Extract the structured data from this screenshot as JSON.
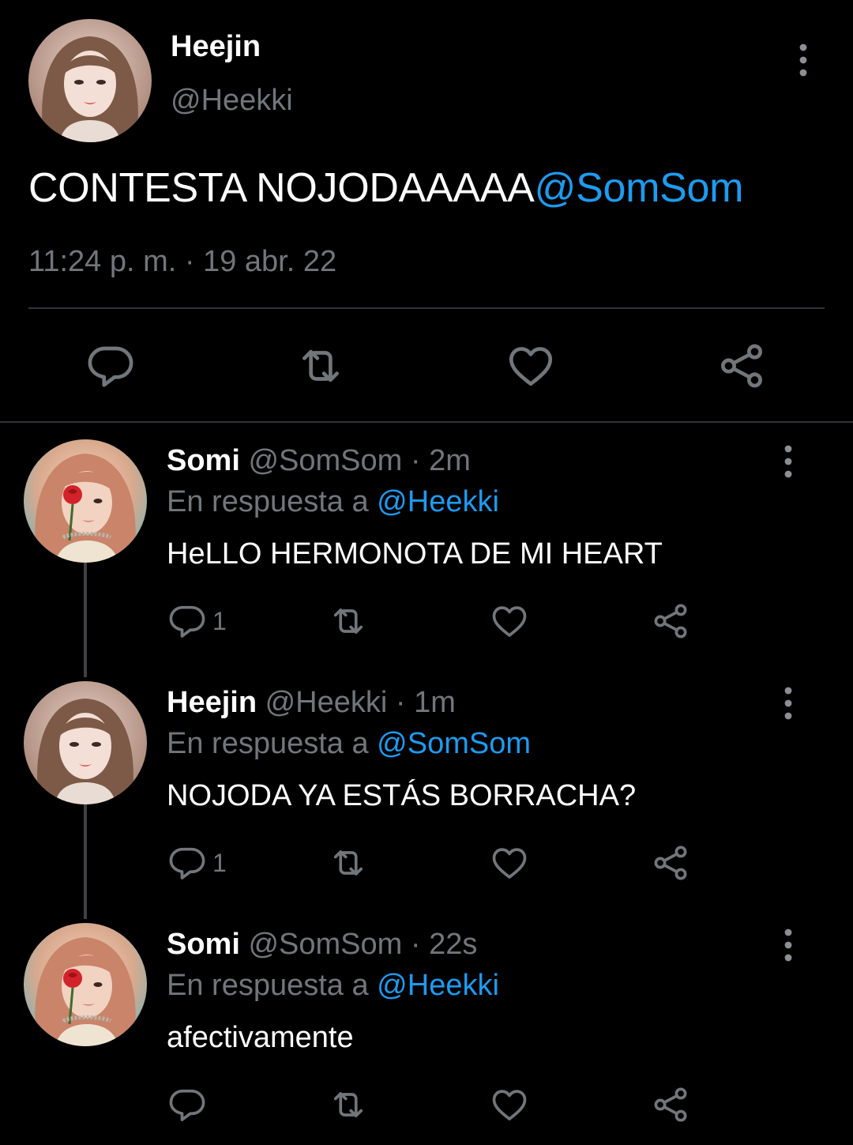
{
  "main_tweet": {
    "author_name": "Heejin",
    "author_handle": "@Heekki",
    "text": "CONTESTA NOJODAAAAA",
    "mention": "@SomSom",
    "timestamp": "11:24 p. m. · 19 abr. 22",
    "actions": [
      "reply-icon",
      "retweet-icon",
      "like-icon",
      "share-icon"
    ]
  },
  "replies": [
    {
      "name": "Somi",
      "handle": "@SomSom",
      "separator": "·",
      "time": "2m",
      "reply_prefix": "En respuesta a",
      "reply_to": "@Heekki",
      "text": "HeLLO HERMONOTA DE MI HEART",
      "reply_count": "1"
    },
    {
      "name": "Heejin",
      "handle": "@Heekki",
      "separator": "·",
      "time": "1m",
      "reply_prefix": "En respuesta a",
      "reply_to": "@SomSom",
      "text": "NOJODA YA ESTÁS BORRACHA?",
      "reply_count": "1"
    },
    {
      "name": "Somi",
      "handle": "@SomSom",
      "separator": "·",
      "time": "22s",
      "reply_prefix": "En respuesta a",
      "reply_to": "@Heekki",
      "text": "afectivamente",
      "reply_count": ""
    }
  ],
  "colors": {
    "background": "#000000",
    "text_primary": "#ffffff",
    "text_secondary": "#71767b",
    "link": "#1d9bf0",
    "divider": "#2f3336"
  }
}
